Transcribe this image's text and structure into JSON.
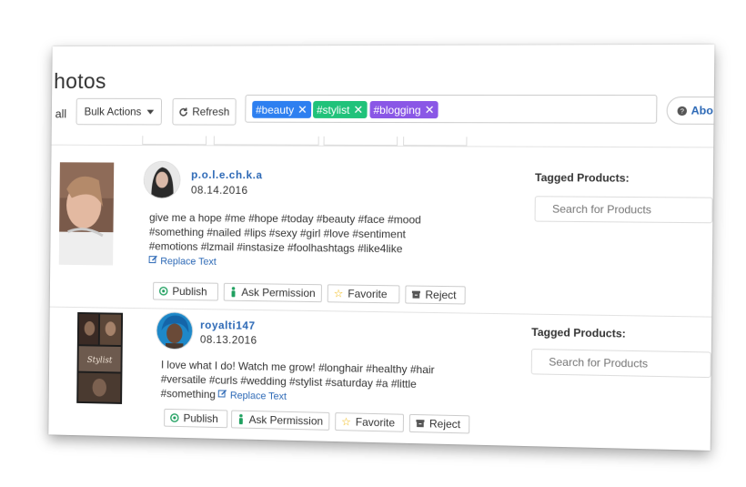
{
  "header": {
    "title": "hotos",
    "select_all": "all",
    "bulk_actions_label": "Bulk Actions",
    "refresh_label": "Refresh",
    "about_label": "Abo"
  },
  "filter_tags": [
    {
      "label": "#beauty",
      "color": "#2d7ff0"
    },
    {
      "label": "#stylist",
      "color": "#20c27a"
    },
    {
      "label": "#blogging",
      "color": "#8a57e6"
    }
  ],
  "colors": {
    "link": "#2a67b5",
    "publish_icon": "#20a060",
    "favorite_icon": "#f0b400"
  },
  "posts": [
    {
      "username": "p.o.l.e.ch.k.a",
      "date": "08.14.2016",
      "caption_lines": [
        "give me a hope #me #hope #today #beauty #face #mood",
        "#something #nailed #lips #sexy #girl #love #sentiment",
        "#emotions #lzmail #instasize #foolhashtags #like4like"
      ],
      "replace_text": "Replace Text",
      "tagged_products_label": "Tagged Products:",
      "search_placeholder": "Search for Products",
      "actions": {
        "publish": "Publish",
        "ask_permission": "Ask Permission",
        "favorite": "Favorite",
        "reject": "Reject"
      }
    },
    {
      "username": "royalti147",
      "date": "08.13.2016",
      "caption_lines": [
        "I love what I do! Watch me grow! #longhair #healthy #hair",
        "#versatile #curls #wedding #stylist #saturday #a #little",
        "#something"
      ],
      "replace_text": "Replace Text",
      "tagged_products_label": "Tagged Products:",
      "search_placeholder": "Search for Products",
      "actions": {
        "publish": "Publish",
        "ask_permission": "Ask Permission",
        "favorite": "Favorite",
        "reject": "Reject"
      }
    }
  ]
}
